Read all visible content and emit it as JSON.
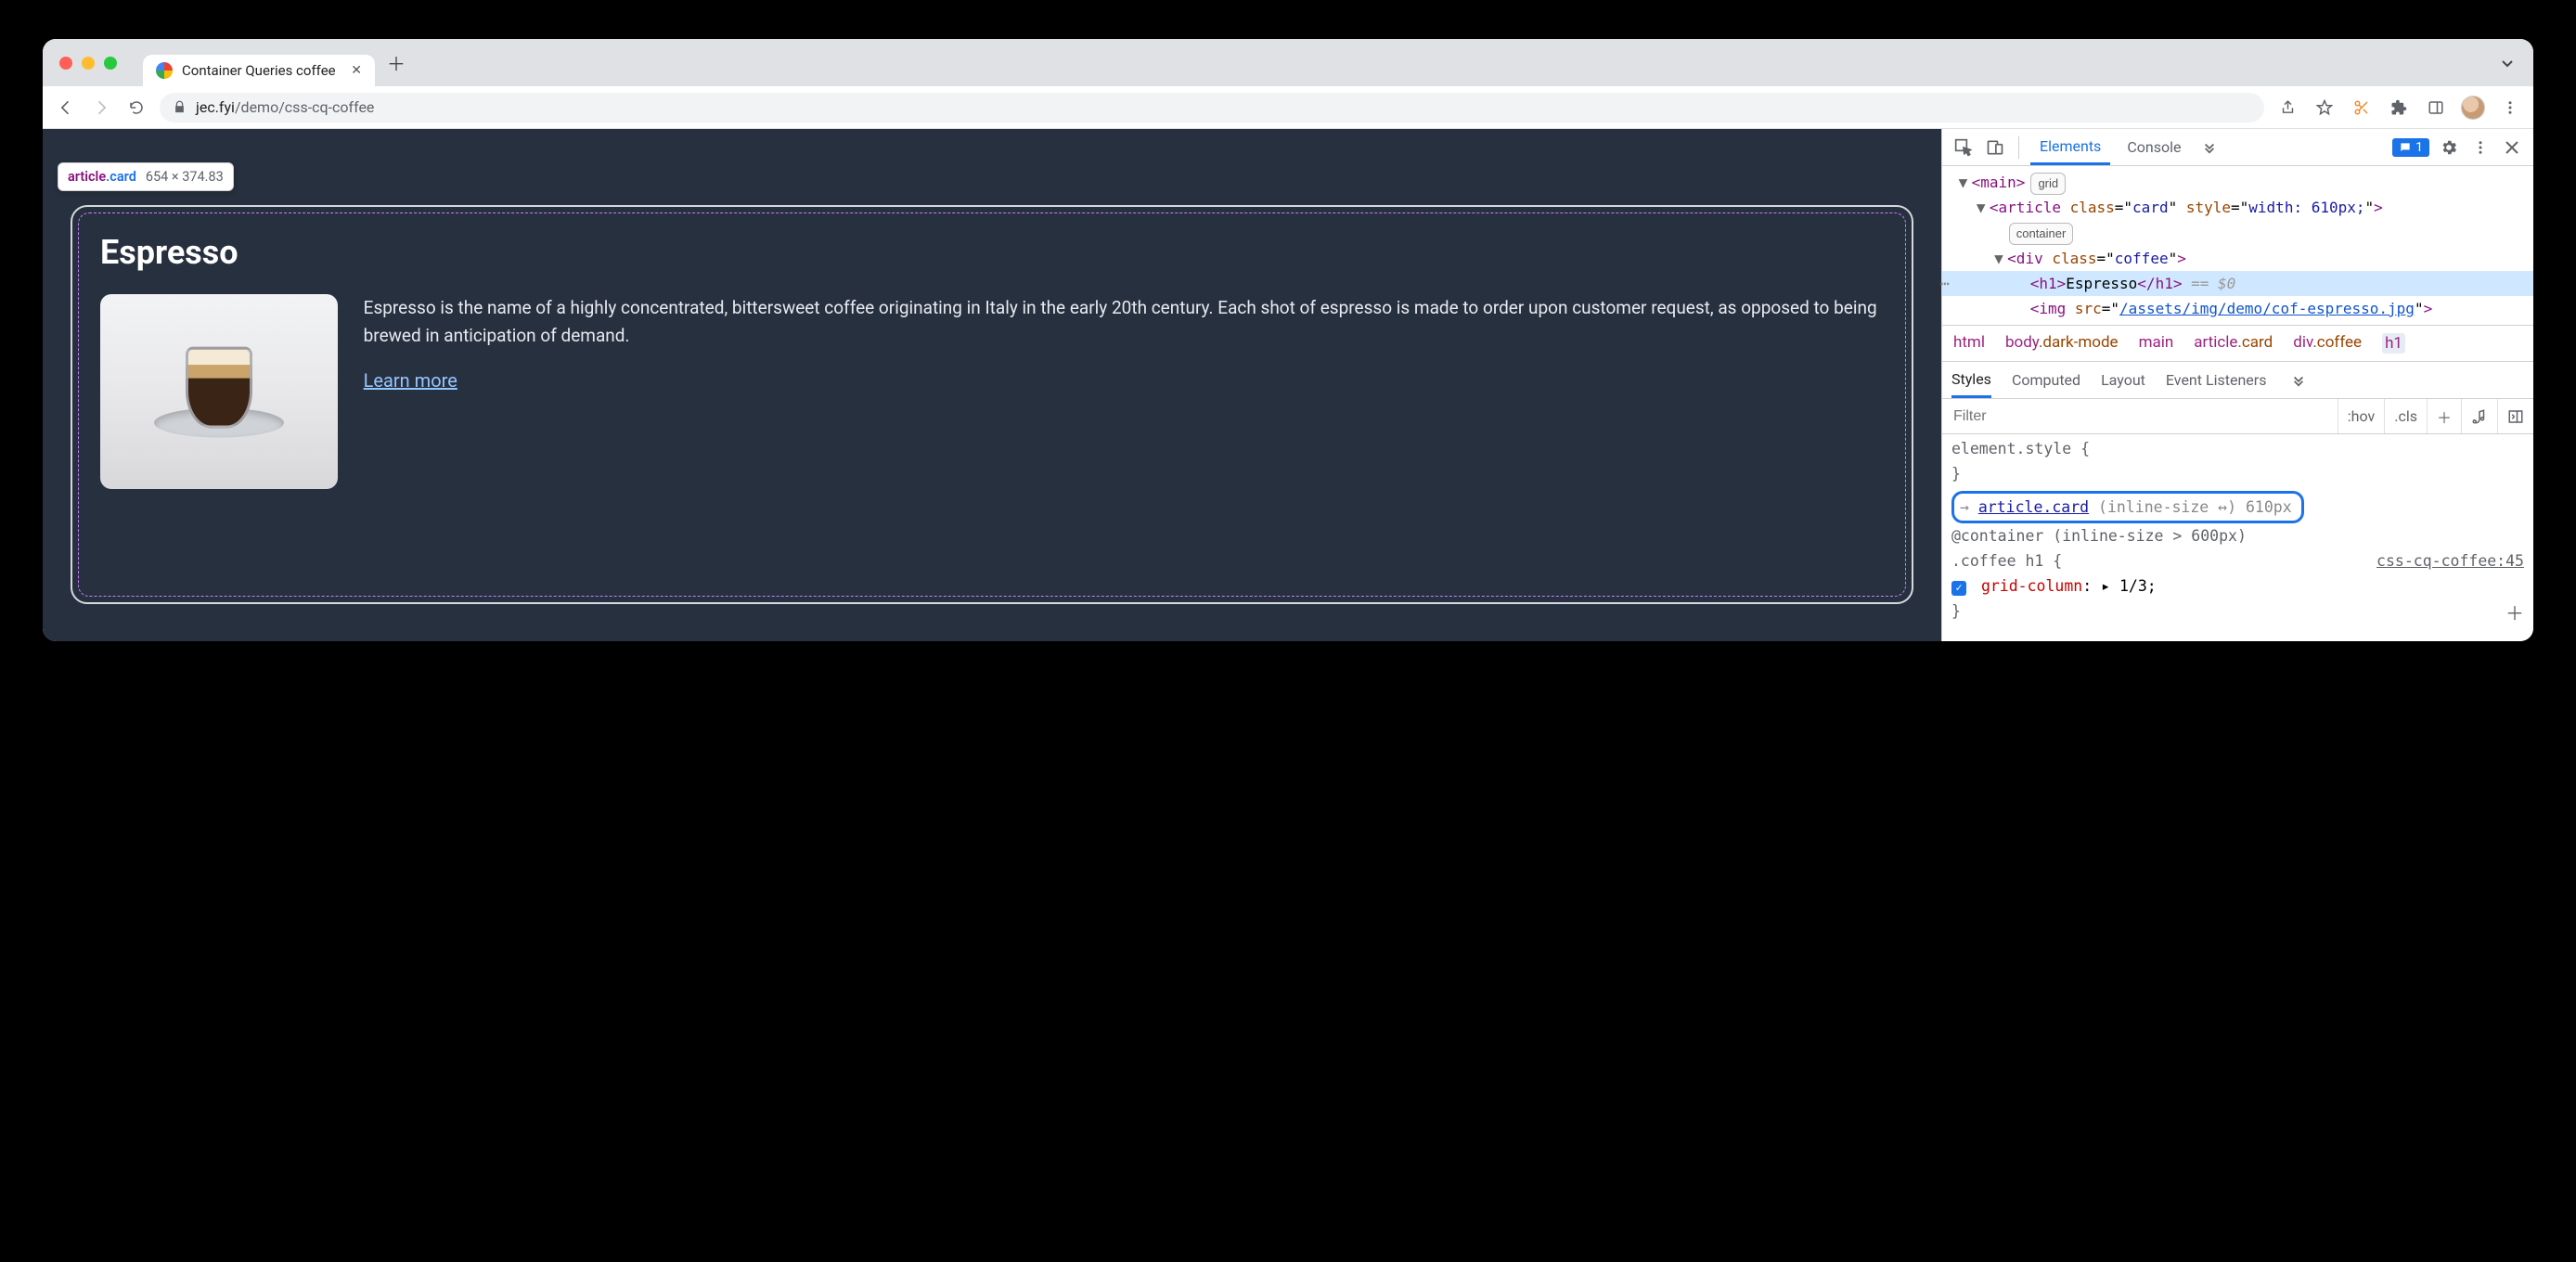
{
  "tab": {
    "title": "Container Queries coffee"
  },
  "url": {
    "host": "jec.fyi",
    "path": "/demo/css-cq-coffee"
  },
  "inspect_tooltip": {
    "tag": "article",
    "class": ".card",
    "dimensions": "654 × 374.83"
  },
  "card": {
    "heading": "Espresso",
    "description": "Espresso is the name of a highly concentrated, bittersweet coffee originating in Italy in the early 20th century. Each shot of espresso is made to order upon customer request, as opposed to being brewed in anticipation of demand.",
    "learn_more": "Learn more"
  },
  "devtools": {
    "tabs": {
      "elements": "Elements",
      "console": "Console"
    },
    "issues_count": "1",
    "dom": {
      "main_open": "<main>",
      "main_badge": "grid",
      "article_open": "<article class=\"card\" style=\"width: 610px;\">",
      "article_badge": "container",
      "div_open": "<div class=\"coffee\">",
      "h1": "<h1>Espresso</h1>",
      "eq": " == $0",
      "img_open": "<img src=\"",
      "img_src": "/assets/img/demo/cof-espresso.jpg",
      "img_close": "\">"
    },
    "breadcrumbs": [
      "html",
      "body.dark-mode",
      "main",
      "article.card",
      "div.coffee",
      "h1"
    ],
    "subtabs": {
      "styles": "Styles",
      "computed": "Computed",
      "layout": "Layout",
      "event_listeners": "Event Listeners"
    },
    "filter": {
      "placeholder": "Filter",
      "hov": ":hov",
      "cls": ".cls"
    },
    "styles": {
      "element_style_open": "element.style {",
      "close_brace": "}",
      "container_label_arrow": "→ ",
      "container_selector": "article.card",
      "container_meta": "(inline-size ↔) 610px",
      "at_container": "@container (inline-size > 600px)",
      "rule_selector": ".coffee h1 {",
      "source": "css-cq-coffee:45",
      "prop_name": "grid-column",
      "prop_value": "1/3",
      "prop_suffix": ";"
    }
  }
}
